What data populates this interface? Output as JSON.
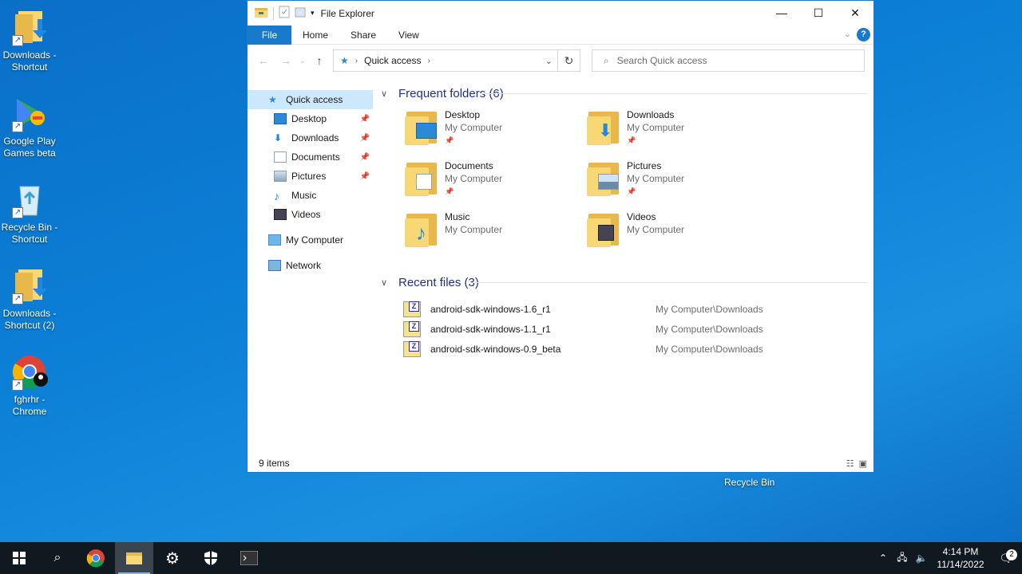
{
  "desktop": {
    "icons": [
      {
        "label": "Downloads - Shortcut",
        "icon": "folder-download-icon"
      },
      {
        "label": "Google Play Games beta",
        "icon": "google-play-games-icon"
      },
      {
        "label": "Recycle Bin - Shortcut",
        "icon": "recycle-bin-icon"
      },
      {
        "label": "Downloads - Shortcut (2)",
        "icon": "folder-download-icon"
      },
      {
        "label": "fghrhr - Chrome",
        "icon": "chrome-profile-icon"
      }
    ],
    "recycle_bin_label": "Recycle Bin"
  },
  "window": {
    "title": "File Explorer",
    "ribbon_tabs": [
      "File",
      "Home",
      "Share",
      "View"
    ],
    "address": {
      "path": "Quick access"
    },
    "search": {
      "placeholder": "Search Quick access"
    },
    "nav_pane": {
      "quick_access": "Quick access",
      "pinned": [
        "Desktop",
        "Downloads",
        "Documents",
        "Pictures"
      ],
      "unpinned": [
        "Music",
        "Videos"
      ],
      "my_computer": "My Computer",
      "network": "Network"
    },
    "frequent": {
      "header": "Frequent folders (6)",
      "folders": [
        {
          "name": "Desktop",
          "location": "My Computer",
          "pinned": true
        },
        {
          "name": "Downloads",
          "location": "My Computer",
          "pinned": true
        },
        {
          "name": "Documents",
          "location": "My Computer",
          "pinned": true
        },
        {
          "name": "Pictures",
          "location": "My Computer",
          "pinned": true
        },
        {
          "name": "Music",
          "location": "My Computer",
          "pinned": false
        },
        {
          "name": "Videos",
          "location": "My Computer",
          "pinned": false
        }
      ]
    },
    "recent": {
      "header": "Recent files (3)",
      "files": [
        {
          "name": "android-sdk-windows-1.6_r1",
          "location": "My Computer\\Downloads"
        },
        {
          "name": "android-sdk-windows-1.1_r1",
          "location": "My Computer\\Downloads"
        },
        {
          "name": "android-sdk-windows-0.9_beta",
          "location": "My Computer\\Downloads"
        }
      ]
    },
    "status": {
      "items": "9 items"
    }
  },
  "taskbar": {
    "clock_time": "4:14 PM",
    "clock_date": "11/14/2022",
    "notifications": "2"
  },
  "colors": {
    "accent": "#1979ca",
    "taskbar": "#101820",
    "desktop": "#0c7fd6"
  }
}
